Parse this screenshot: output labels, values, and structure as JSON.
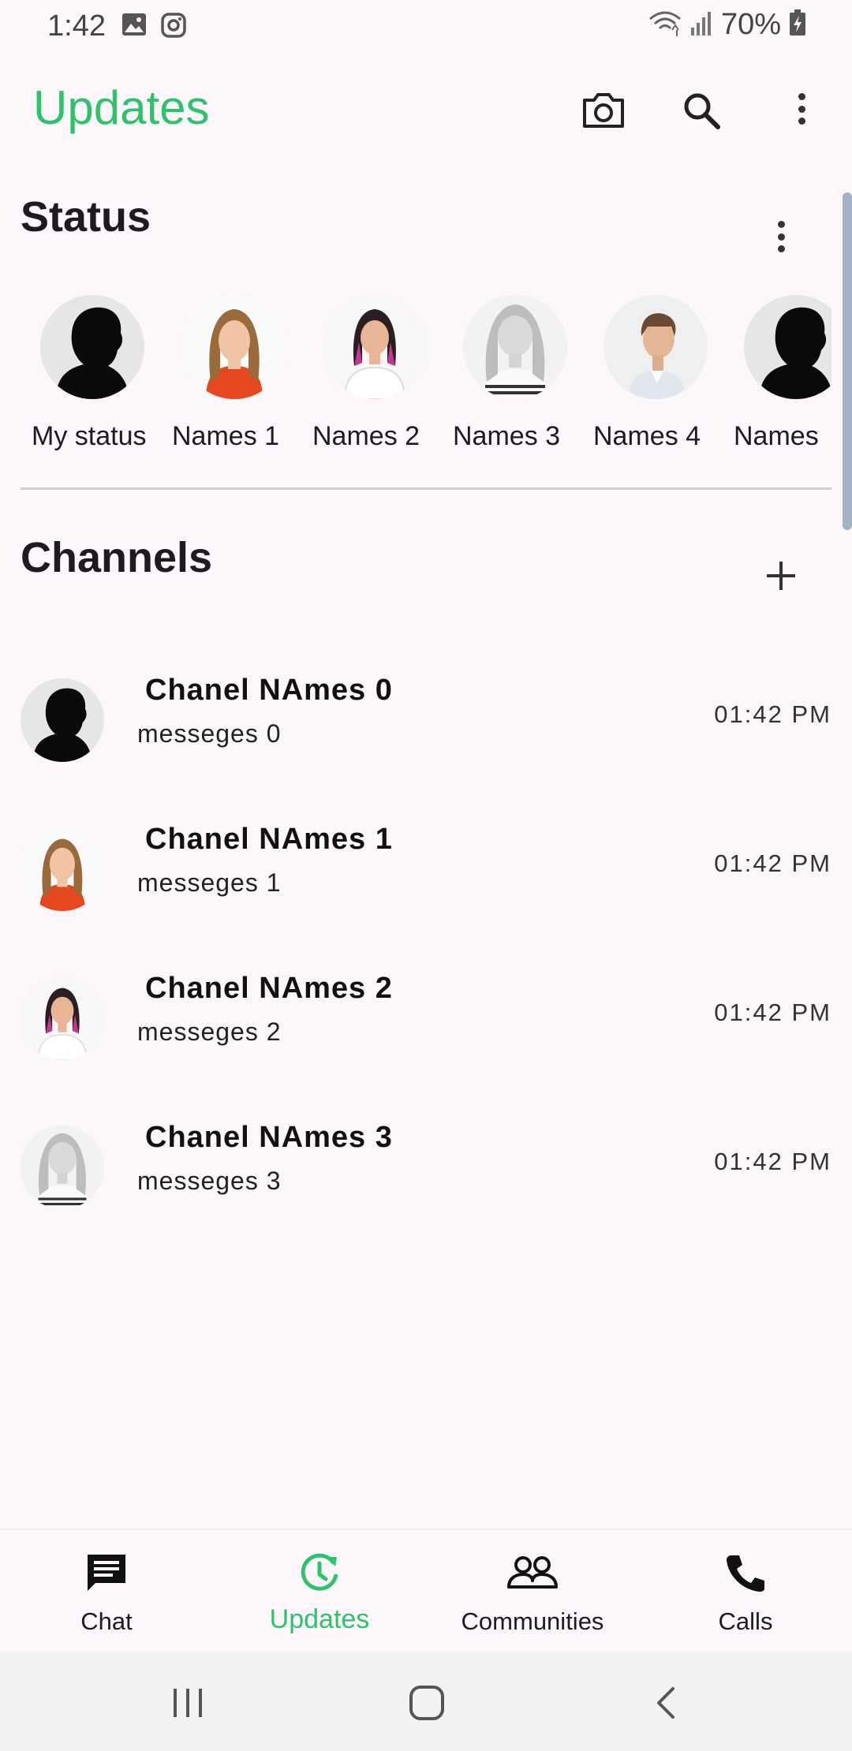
{
  "status_bar": {
    "time": "1:42",
    "battery": "70%",
    "icons": [
      "image-icon",
      "instagram-icon",
      "wifi-icon",
      "signal-icon",
      "battery-icon"
    ]
  },
  "app_bar": {
    "title": "Updates",
    "title_color": "#2cc36b",
    "actions": [
      "camera-icon",
      "search-icon",
      "more-vert-icon"
    ]
  },
  "status_section": {
    "title": "Status",
    "items": [
      {
        "label": "My status",
        "avatar": "silhouette"
      },
      {
        "label": "Names 1",
        "avatar": "woman-red-shirt"
      },
      {
        "label": "Names 2",
        "avatar": "woman-pink-hair"
      },
      {
        "label": "Names 3",
        "avatar": "woman-grayscale"
      },
      {
        "label": "Names 4",
        "avatar": "man-portrait"
      },
      {
        "label": "Names",
        "avatar": "silhouette"
      }
    ]
  },
  "channels_section": {
    "title": "Channels",
    "items": [
      {
        "name": "Chanel NAmes 0",
        "message": "messeges 0",
        "time": "01:42 PM",
        "avatar": "silhouette"
      },
      {
        "name": "Chanel NAmes 1",
        "message": "messeges 1",
        "time": "01:42 PM",
        "avatar": "woman-red-shirt"
      },
      {
        "name": "Chanel NAmes 2",
        "message": "messeges 2",
        "time": "01:42 PM",
        "avatar": "woman-pink-hair"
      },
      {
        "name": "Chanel NAmes 3",
        "message": "messeges 3",
        "time": "01:42 PM",
        "avatar": "woman-grayscale"
      }
    ]
  },
  "bottom_nav": {
    "items": [
      {
        "label": "Chat",
        "icon": "chat-icon"
      },
      {
        "label": "Updates",
        "icon": "updates-icon",
        "active": true
      },
      {
        "label": "Communities",
        "icon": "communities-icon"
      },
      {
        "label": "Calls",
        "icon": "phone-icon"
      }
    ]
  },
  "system_nav": [
    "recents-icon",
    "home-icon",
    "back-icon"
  ]
}
